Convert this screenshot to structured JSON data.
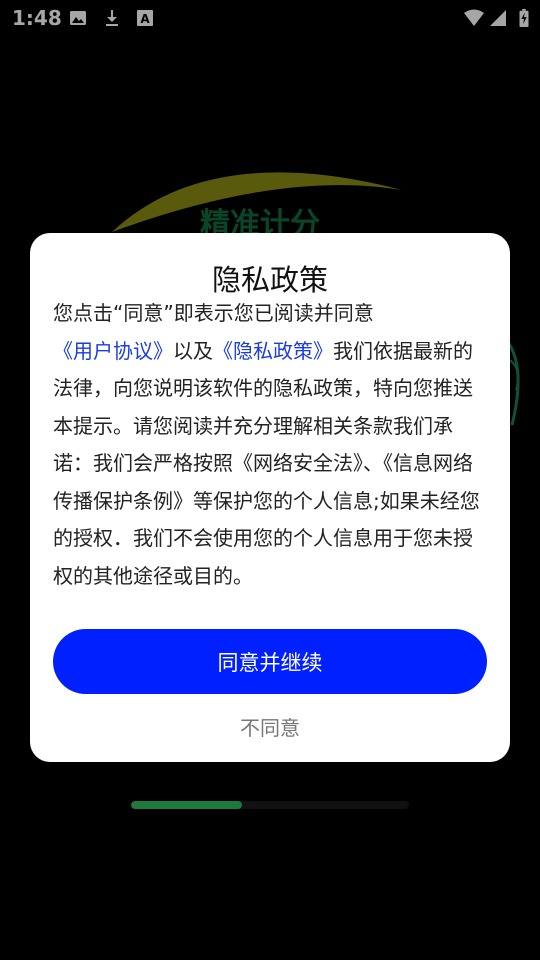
{
  "status_bar": {
    "time": "1:48",
    "left_icons": [
      "image-icon",
      "download-icon",
      "font-icon"
    ],
    "right_icons": [
      "wifi-icon",
      "signal-icon",
      "battery-charging-icon"
    ]
  },
  "splash": {
    "logo_text": "精准计分",
    "loading_progress": 0.4,
    "progress_color": "#1c7a3e"
  },
  "dialog": {
    "title": "隐私政策",
    "body": {
      "text_1": "您点击“同意”即表示您已阅读并同意",
      "link_1": "《用户协议》",
      "text_2": "以及",
      "link_2": "《隐私政策》",
      "text_3": "我们依据最新的法律，向您说明该软件的隐私政策，特向您推送本提示。请您阅读并充分理解相关条款我们承诺：我们会严格按照《网络安全法》、《信息网络传播保护条例》等保护您的个人信息;如果未经您的授权．我们不会使用您的个人信息用于您未授权的其他途径或目的。"
    },
    "agree_label": "同意并继续",
    "disagree_label": "不同意",
    "accent_color": "#0020ff"
  }
}
